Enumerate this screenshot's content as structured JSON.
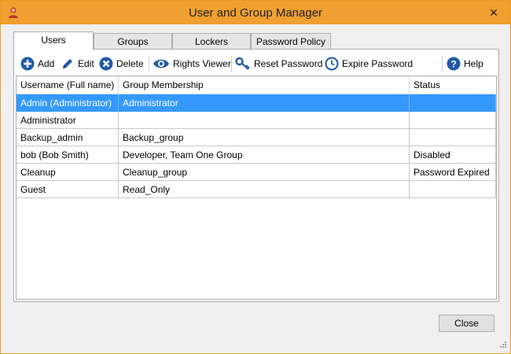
{
  "window": {
    "title": "User and Group Manager",
    "close_glyph": "✕"
  },
  "tabs": [
    {
      "label": "Users",
      "active": true
    },
    {
      "label": "Groups"
    },
    {
      "label": "Lockers"
    },
    {
      "label": "Password Policy"
    }
  ],
  "toolbar": {
    "add": {
      "label": "Add",
      "icon": "plus-circle-icon"
    },
    "edit": {
      "label": "Edit",
      "icon": "pencil-icon"
    },
    "delete": {
      "label": "Delete",
      "icon": "x-circle-icon"
    },
    "rights": {
      "label": "Rights Viewer",
      "icon": "eye-icon"
    },
    "reset": {
      "label": "Reset Password",
      "icon": "key-icon"
    },
    "expire": {
      "label": "Expire Password",
      "icon": "clock-icon"
    },
    "help": {
      "label": "Help",
      "icon": "help-icon"
    }
  },
  "table": {
    "columns": [
      "Username (Full name)",
      "Group Membership",
      "Status"
    ],
    "rows": [
      {
        "username": "Admin (Administrator)",
        "groups": "Administrator",
        "status": "",
        "selected": true
      },
      {
        "username": "Administrator",
        "groups": "",
        "status": ""
      },
      {
        "username": "Backup_admin",
        "groups": "Backup_group",
        "status": ""
      },
      {
        "username": "bob (Bob Smith)",
        "groups": "Developer, Team One Group",
        "status": "Disabled"
      },
      {
        "username": "Cleanup",
        "groups": "Cleanup_group",
        "status": "Password Expired"
      },
      {
        "username": "Guest",
        "groups": "Read_Only",
        "status": ""
      }
    ]
  },
  "footer": {
    "close_label": "Close"
  },
  "colors": {
    "accent": "#f0a030",
    "selection": "#3399ff",
    "icon_blue": "#1f5aa6"
  }
}
